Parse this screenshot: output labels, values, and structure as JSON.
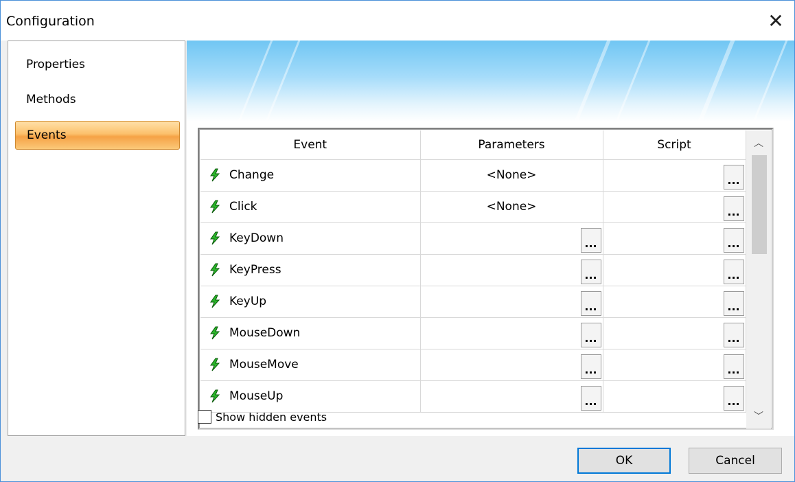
{
  "window": {
    "title": "Configuration",
    "close_glyph": "✕"
  },
  "sidebar": {
    "items": [
      {
        "label": "Properties",
        "active": false
      },
      {
        "label": "Methods",
        "active": false
      },
      {
        "label": "Events",
        "active": true
      }
    ]
  },
  "grid": {
    "columns": [
      "Event",
      "Parameters",
      "Script"
    ],
    "rows": [
      {
        "event": "Change",
        "parameters": "<None>"
      },
      {
        "event": "Click",
        "parameters": "<None>"
      },
      {
        "event": "KeyDown",
        "parameters": ""
      },
      {
        "event": "KeyPress",
        "parameters": ""
      },
      {
        "event": "KeyUp",
        "parameters": ""
      },
      {
        "event": "MouseDown",
        "parameters": ""
      },
      {
        "event": "MouseMove",
        "parameters": ""
      },
      {
        "event": "MouseUp",
        "parameters": ""
      }
    ],
    "ellipsis_label": "...",
    "bolt_icon": "lightning-bolt-icon",
    "bolt_color": "#2bb52b"
  },
  "scroll": {
    "up_glyph": "︿",
    "down_glyph": "﹀"
  },
  "options": {
    "show_hidden_label": "Show hidden events",
    "show_hidden_checked": false
  },
  "footer": {
    "ok_label": "OK",
    "cancel_label": "Cancel"
  },
  "colors": {
    "accent": "#0078d7",
    "active_item": "#f5a246"
  }
}
